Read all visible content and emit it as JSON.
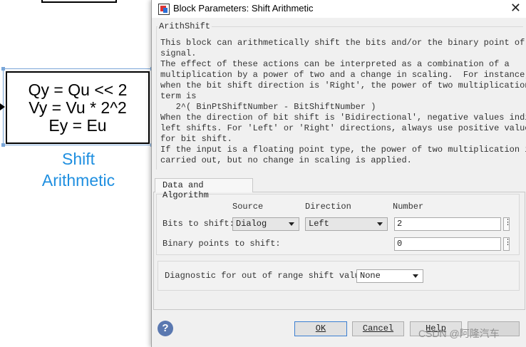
{
  "canvas": {
    "block": {
      "lines": [
        "Qy = Qu << 2",
        "Vy = Vu * 2^2",
        "Ey = Eu"
      ],
      "name_line1": "Shift",
      "name_line2": "Arithmetic"
    }
  },
  "dialog": {
    "title": "Block Parameters: Shift Arithmetic",
    "group_title": "ArithShift",
    "description": "This block can arithmetically shift the bits and/or the binary point of a\nsignal.\nThe effect of these actions can be interpreted as a combination of a\nmultiplication by a power of two and a change in scaling.  For instance,\nwhen the bit shift direction is 'Right', the power of two multiplication\nterm is\n   2^( BinPtShiftNumber - BitShiftNumber )\nWhen the direction of bit shift is 'Bidirectional', negative values indicate\nleft shifts. For 'Left' or 'Right' directions, always use positive values\nfor bit shift.\nIf the input is a floating point type, the power of two multiplication is\ncarried out, but no change in scaling is applied.",
    "tab_label": "Data and Algorithm",
    "headers": {
      "source": "Source",
      "direction": "Direction",
      "number": "Number"
    },
    "bits_to_shift": {
      "label": "Bits to shift:",
      "source": "Dialog",
      "direction": "Left",
      "number": "2"
    },
    "binary_points": {
      "label": "Binary points to shift:",
      "number": "0"
    },
    "diagnostic": {
      "label": "Diagnostic for out of range shift value:",
      "value": "None"
    },
    "dots_label": "⋮",
    "buttons": {
      "ok": "OK",
      "cancel": "Cancel",
      "help": "Help",
      "apply": ""
    },
    "watermark": "CSDN @阿隆汽车"
  }
}
